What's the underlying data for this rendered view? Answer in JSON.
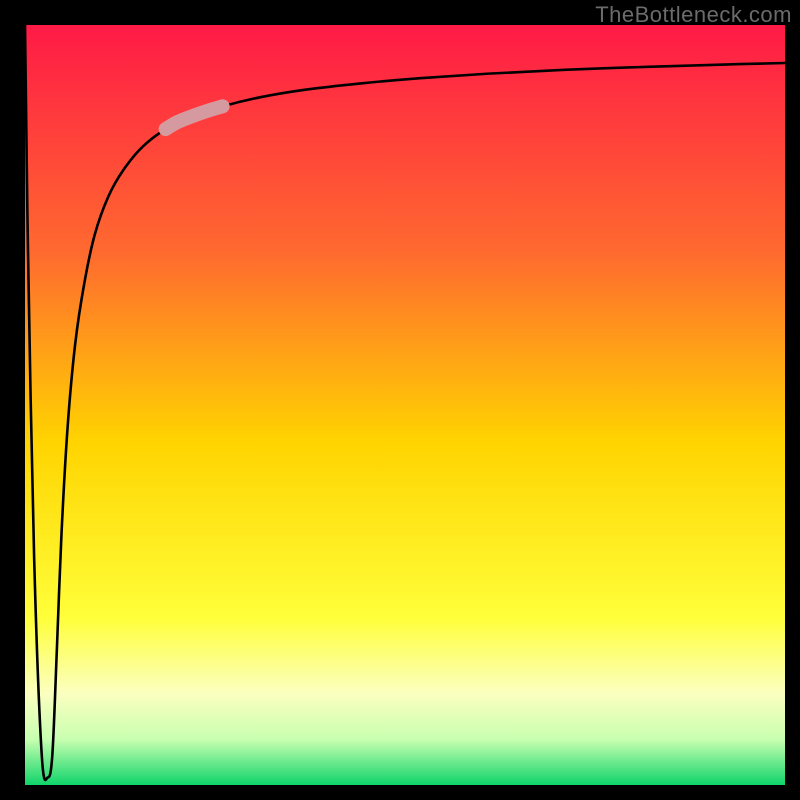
{
  "watermark": "TheBottleneck.com",
  "chart_data": {
    "type": "line",
    "title": "",
    "xlabel": "",
    "ylabel": "",
    "xlim": [
      0,
      100
    ],
    "ylim": [
      0,
      100
    ],
    "grid": false,
    "legend": false,
    "background_gradient": {
      "stops": [
        {
          "offset": 0.0,
          "color": "#ff1a46"
        },
        {
          "offset": 0.3,
          "color": "#ff6a2f"
        },
        {
          "offset": 0.55,
          "color": "#ffd400"
        },
        {
          "offset": 0.78,
          "color": "#ffff3a"
        },
        {
          "offset": 0.88,
          "color": "#fbffc0"
        },
        {
          "offset": 0.94,
          "color": "#c8ffb0"
        },
        {
          "offset": 1.0,
          "color": "#0fd46a"
        }
      ]
    },
    "series": [
      {
        "name": "bottleneck-curve",
        "x": [
          0.0,
          0.4,
          1.2,
          2.2,
          3.0,
          3.6,
          4.2,
          4.8,
          5.6,
          6.6,
          7.8,
          9.2,
          11.0,
          13.0,
          15.5,
          18.5,
          22.0,
          26.0,
          31.0,
          37.0,
          44.0,
          52.0,
          61.0,
          71.0,
          82.0,
          92.0,
          100.0
        ],
        "y": [
          100.0,
          70.0,
          30.0,
          4.0,
          1.0,
          4.0,
          18.0,
          33.0,
          47.0,
          58.0,
          66.0,
          72.5,
          77.5,
          81.0,
          84.0,
          86.3,
          88.0,
          89.3,
          90.5,
          91.5,
          92.3,
          93.0,
          93.6,
          94.1,
          94.5,
          94.8,
          95.0
        ]
      }
    ],
    "highlight": {
      "name": "highlight-segment",
      "color": "#d59aa0",
      "x": [
        18.5,
        20.0,
        22.0,
        24.0,
        26.0
      ],
      "y": [
        86.3,
        87.2,
        88.0,
        88.7,
        89.3
      ]
    },
    "minimum_point": {
      "x": 3.0,
      "y": 1.0
    }
  }
}
